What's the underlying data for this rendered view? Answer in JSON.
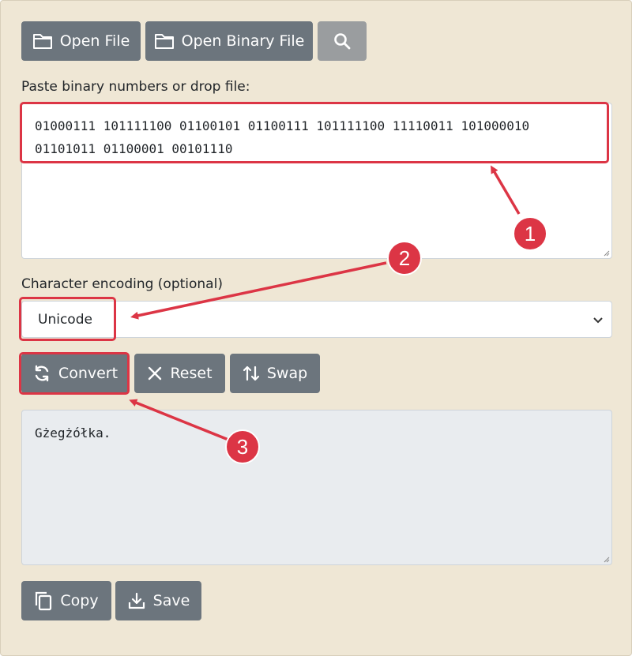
{
  "toolbar": {
    "open_file_label": "Open File",
    "open_binary_file_label": "Open Binary File",
    "search_icon": "search-icon",
    "folder_icon": "folder-icon"
  },
  "input": {
    "label": "Paste binary numbers or drop file:",
    "value": "01000111 101111100 01100101 01100111 101111100 11110011 101000010\n01101011 01100001 00101110"
  },
  "encoding": {
    "label": "Character encoding (optional)",
    "selected": "Unicode"
  },
  "actions": {
    "convert_label": "Convert",
    "reset_label": "Reset",
    "swap_label": "Swap"
  },
  "output": {
    "value": "Gżegżółka."
  },
  "output_actions": {
    "copy_label": "Copy",
    "save_label": "Save"
  },
  "annotations": {
    "step1": "1",
    "step2": "2",
    "step3": "3",
    "color": "#dc3545"
  }
}
